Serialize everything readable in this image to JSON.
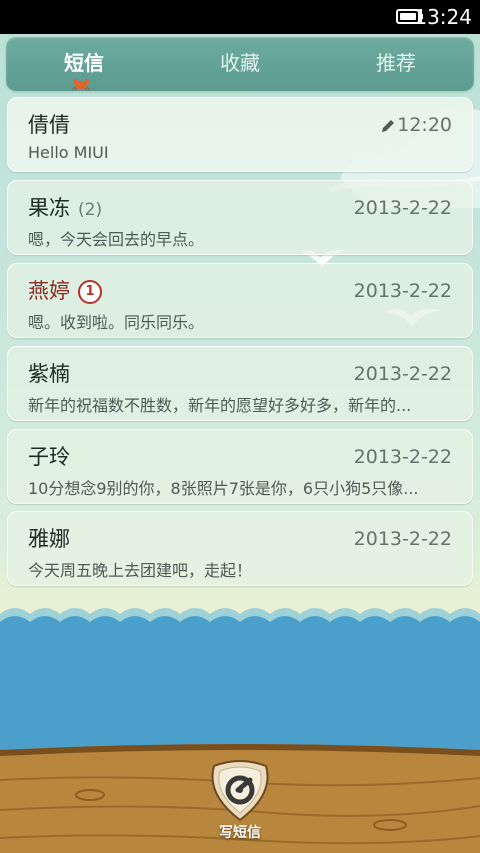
{
  "status_bar": {
    "time": "13:24"
  },
  "tabs": [
    {
      "label": "短信",
      "active": true
    },
    {
      "label": "收藏",
      "active": false
    },
    {
      "label": "推荐",
      "active": false
    }
  ],
  "conversations": [
    {
      "name": "倩倩",
      "count": "",
      "unread_badge": "",
      "date": "12:20",
      "draft": true,
      "preview": "Hello MIUI"
    },
    {
      "name": "果冻",
      "count": "(2)",
      "unread_badge": "",
      "date": "2013-2-22",
      "draft": false,
      "preview": "嗯，今天会回去的早点。"
    },
    {
      "name": "燕婷",
      "count": "",
      "unread_badge": "1",
      "date": "2013-2-22",
      "draft": false,
      "preview": "嗯。收到啦。同乐同乐。"
    },
    {
      "name": "紫楠",
      "count": "",
      "unread_badge": "",
      "date": "2013-2-22",
      "draft": false,
      "preview": "新年的祝福数不胜数，新年的愿望好多好多，新年的..."
    },
    {
      "name": "子玲",
      "count": "",
      "unread_badge": "",
      "date": "2013-2-22",
      "draft": false,
      "preview": "10分想念9别的你，8张照片7张是你，6只小狗5只像..."
    },
    {
      "name": "雅娜",
      "count": "",
      "unread_badge": "",
      "date": "2013-2-22",
      "draft": false,
      "preview": "今天周五晚上去团建吧，走起！"
    }
  ],
  "compose": {
    "label": "写短信"
  },
  "colors": {
    "tab_bar": "#5c9c90",
    "unread_name": "#8a2a20",
    "badge": "#b8312a",
    "sea": "#4a9fcb",
    "wood": "#b8863c"
  }
}
